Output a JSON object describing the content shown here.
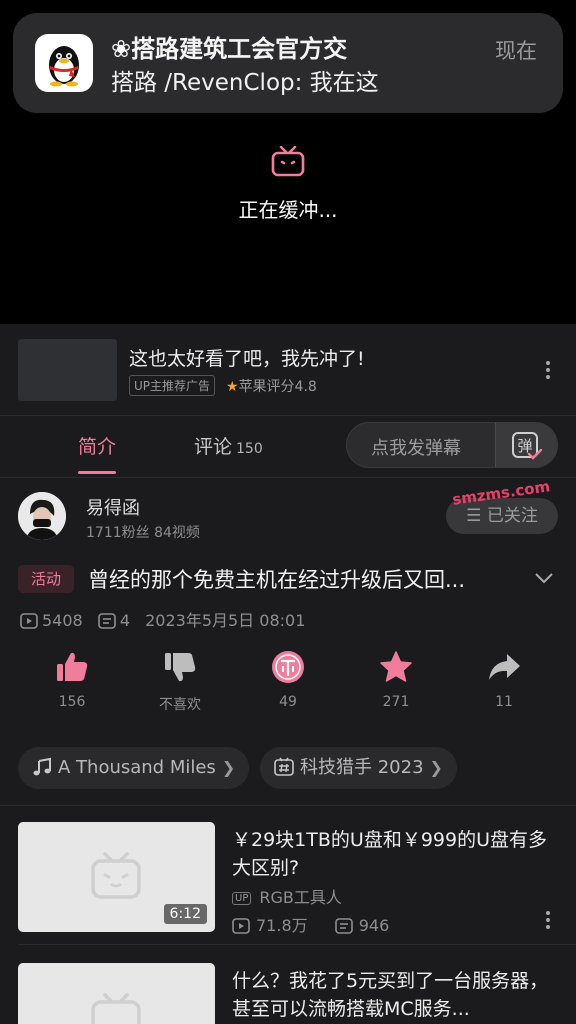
{
  "notification": {
    "title": "❀搭路建筑工会官方交",
    "body": "搭路 /RevenClop: 我在这",
    "time": "现在",
    "app_icon": "qq-penguin-icon"
  },
  "player": {
    "status_text": "正在缓冲..."
  },
  "ad": {
    "title": "这也太好看了吧，我先冲了!",
    "tag": "UP主推荐广告",
    "rating": "苹果评分4.8"
  },
  "tabs": {
    "intro": "简介",
    "comments": "评论",
    "comments_count": "150",
    "danmaku_placeholder": "点我发弹幕",
    "danmaku_button": "弹"
  },
  "uploader": {
    "name": "易得函",
    "stats": "1711粉丝  84视频",
    "follow_label": "☰ 已关注",
    "watermark": "smzms.com"
  },
  "video": {
    "activity_tag": "活动",
    "title": "曾经的那个免费主机在经过升级后又回...",
    "views": "5408",
    "danmaku_count": "4",
    "date": "2023年5月5日  08:01"
  },
  "actions": {
    "like": "156",
    "dislike": "不喜欢",
    "coin": "49",
    "favorite": "271",
    "share": "11"
  },
  "chips": {
    "music": "A Thousand Miles",
    "event": "科技猎手 2023"
  },
  "recommendations": [
    {
      "title": "￥29块1TB的U盘和￥999的U盘有多大区别?",
      "owner": "RGB工具人",
      "duration": "6:12",
      "views": "71.8万",
      "danmaku": "946"
    },
    {
      "title": "什么？我花了5元买到了一台服务器，甚至可以流畅搭载MC服务..."
    }
  ],
  "colors": {
    "accent": "#f07d9b",
    "background": "#1b1b1d",
    "player": "#000000"
  }
}
